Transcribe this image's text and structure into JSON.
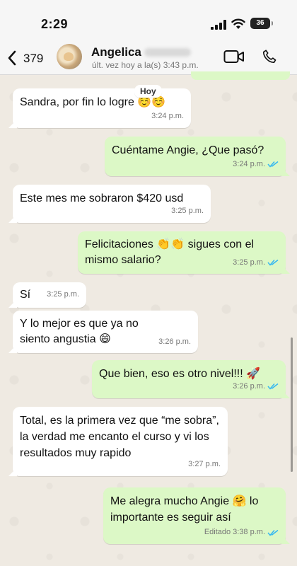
{
  "status_bar": {
    "time": "2:29",
    "battery": "36"
  },
  "header": {
    "back_count": "379",
    "contact_name": "Angelica",
    "last_seen": "últ. vez hoy a la(s) 3:43 p.m."
  },
  "chat": {
    "date_label": "Hoy",
    "messages": [
      {
        "text": "Sandra, por fin lo logre ☺️☺️",
        "time": "3:24 p.m."
      },
      {
        "text": "Cuéntame Angie, ¿Que pasó?",
        "time": "3:24 p.m."
      },
      {
        "text": "Este mes me sobraron $420 usd",
        "time": "3:25 p.m."
      },
      {
        "text": "Felicitaciones 👏👏 sigues con el mismo salario?",
        "time": "3:25 p.m."
      },
      {
        "text": "Sí",
        "time": "3:25 p.m."
      },
      {
        "text": "Y lo mejor es que ya no siento angustia 😄",
        "time": "3:26 p.m."
      },
      {
        "text": "Que bien, eso es otro nivel!!! 🚀",
        "time": "3:26 p.m."
      },
      {
        "text": "Total, es la primera vez que “me sobra”, la verdad me encanto el curso y vi los resultados muy rapido",
        "time": "3:27 p.m."
      },
      {
        "text": "Me alegra mucho Angie 🤗 lo importante es seguir así",
        "time": "3:38 p.m.",
        "edited_label": "Editado"
      }
    ]
  },
  "colors": {
    "incoming": "#ffffff",
    "outgoing": "#dcf8c6",
    "tick_blue": "#34b7f1",
    "background": "#efeae2"
  },
  "icons": [
    "signal-icon",
    "wifi-icon",
    "battery-icon",
    "back-chevron-icon",
    "video-call-icon",
    "phone-call-icon",
    "double-check-icon"
  ]
}
